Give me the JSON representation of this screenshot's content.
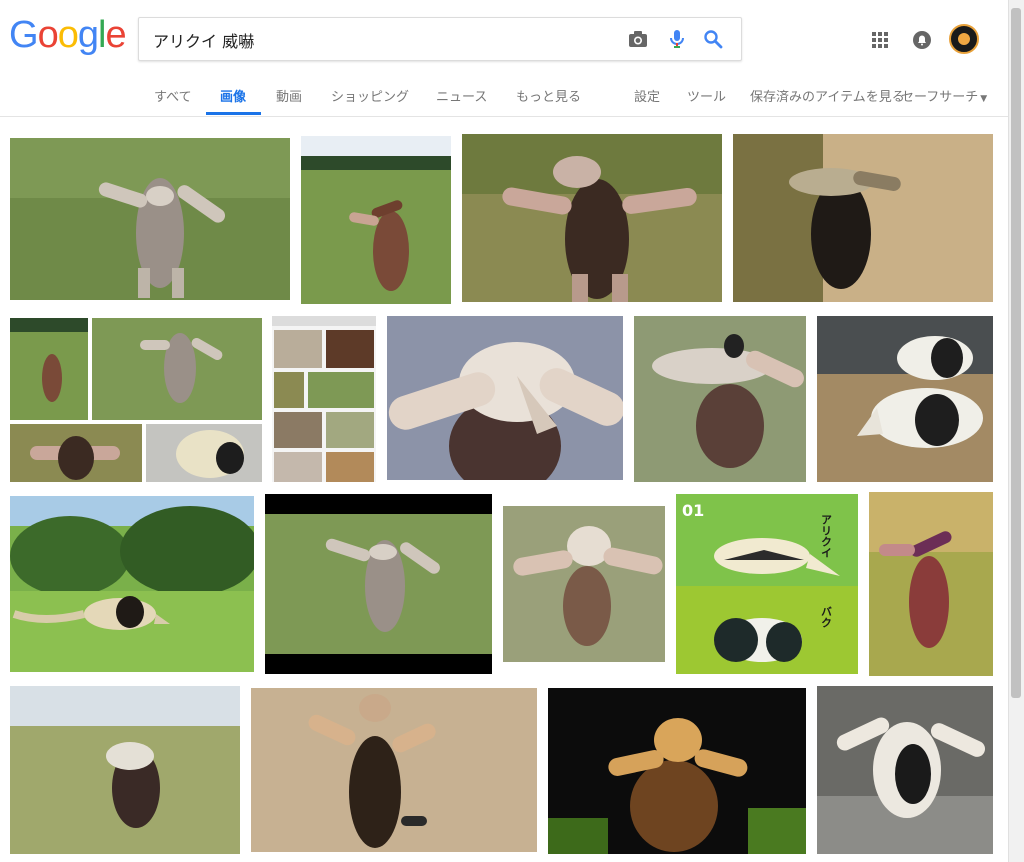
{
  "logo": {
    "letters": [
      "G",
      "o",
      "o",
      "g",
      "l",
      "e"
    ],
    "colors": [
      "#4285f4",
      "#ea4335",
      "#fbbc05",
      "#4285f4",
      "#34a853",
      "#ea4335"
    ]
  },
  "search": {
    "query": "アリクイ 威嚇"
  },
  "icons": {
    "camera": "camera-icon",
    "mic": "mic-icon",
    "search": "search-icon",
    "apps": "apps-grid-icon",
    "notifications": "notifications-icon",
    "account": "account-avatar-icon"
  },
  "tabs": {
    "all": "すべて",
    "images": "画像",
    "videos": "動画",
    "shopping": "ショッピング",
    "news": "ニュース",
    "more": "もっと見る",
    "settings": "設定",
    "tools": "ツール",
    "saved": "保存済みのアイテムを見る",
    "safesearch": "セーフサーチ"
  },
  "results": {
    "row3_img4_text": {
      "num": "01",
      "anteater": "アリクイ",
      "tapir": "バク"
    }
  },
  "colors": {
    "accent": "#1a73e8"
  }
}
